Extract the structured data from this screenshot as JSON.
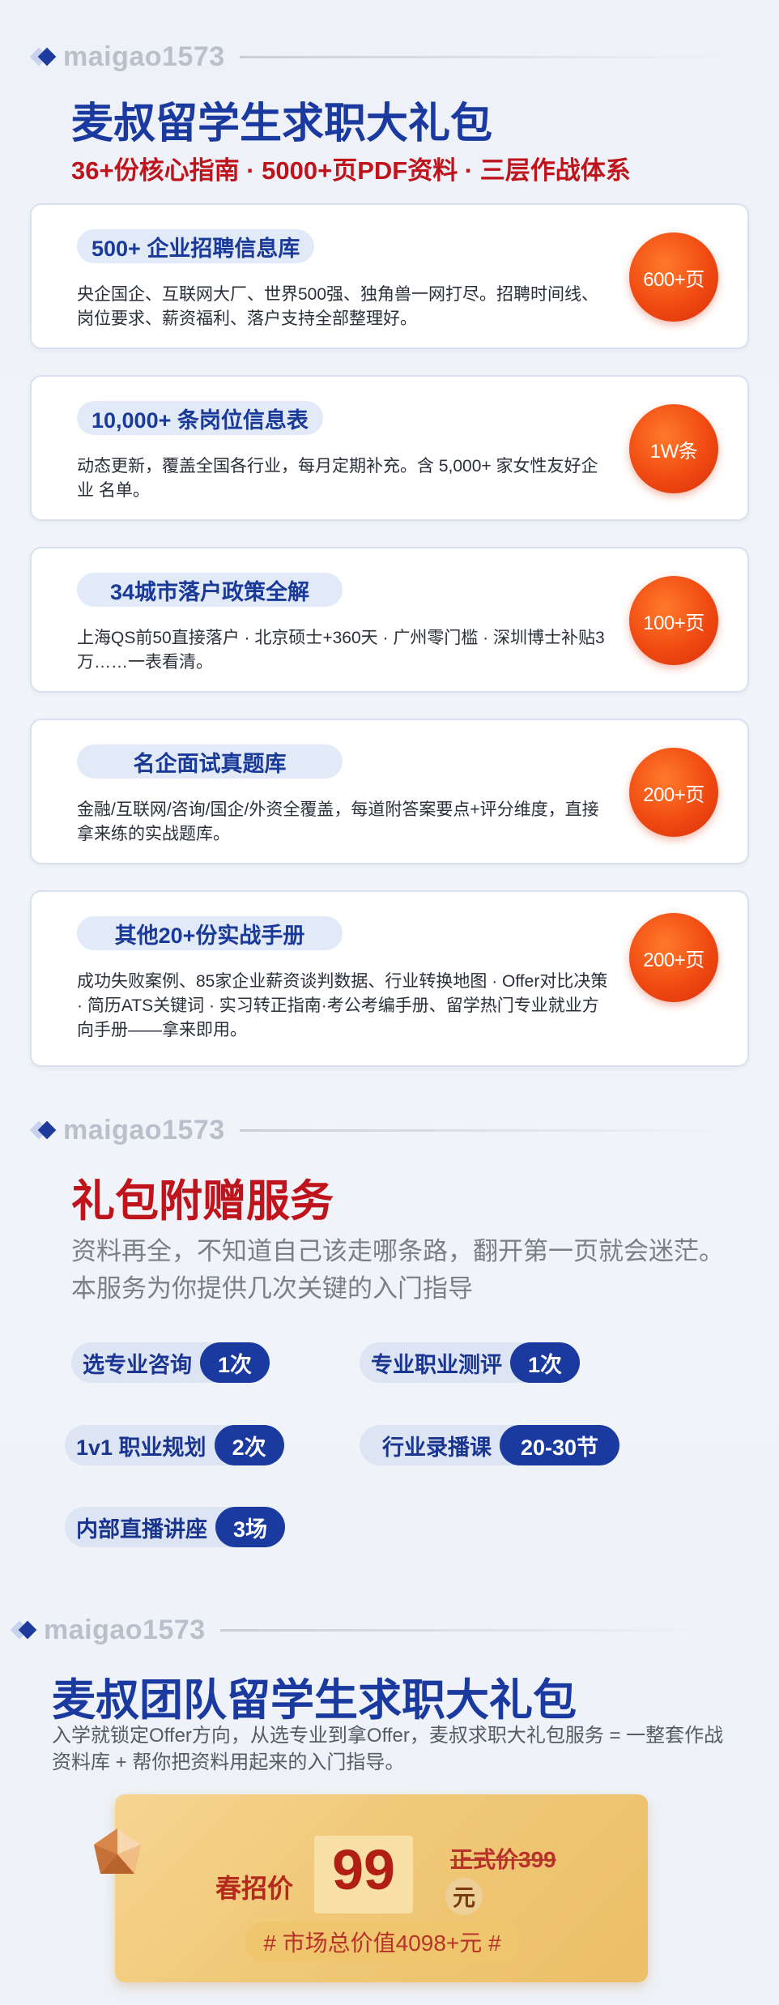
{
  "brand": "maigao1573",
  "section1": {
    "title": "麦叔留学生求职大礼包",
    "subtitle": "36+份核心指南 · 5000+页PDF资料 · 三层作战体系"
  },
  "cards": [
    {
      "pill": "500+ 企业招聘信息库",
      "desc": "央企国企、互联网大厂、世界500强、独角兽一网打尽。招聘时间线、岗位要求、薪资福利、落户支持全部整理好。",
      "badge": "600+页"
    },
    {
      "pill": "10,000+ 条岗位信息表",
      "desc": "动态更新，覆盖全国各行业，每月定期补充。含 5,000+ 家女性友好企业 名单。",
      "badge": "1W条"
    },
    {
      "pill": "34城市落户政策全解",
      "desc": "上海QS前50直接落户 · 北京硕士+360天 · 广州零门槛 · 深圳博士补贴3万……一表看清。",
      "badge": "100+页"
    },
    {
      "pill": "名企面试真题库",
      "desc": "金融/互联网/咨询/国企/外资全覆盖，每道附答案要点+评分维度，直接拿来练的实战题库。",
      "badge": "200+页"
    },
    {
      "pill": "其他20+份实战手册",
      "desc": "成功失败案例、85家企业薪资谈判数据、行业转换地图 · Offer对比决策 · 简历ATS关键词 · 实习转正指南·考公考编手册、留学热门专业就业方向手册——拿来即用。",
      "badge": "200+页"
    }
  ],
  "section2": {
    "title": "礼包附赠服务",
    "desc": "资料再全，不知道自己该走哪条路，翻开第一页就会迷茫。本服务为你提供几次关键的入门指导",
    "services": [
      {
        "name": "选专业咨询",
        "count": "1次"
      },
      {
        "name": "专业职业测评",
        "count": "1次"
      },
      {
        "name": "1v1 职业规划",
        "count": "2次"
      },
      {
        "name": "行业录播课",
        "count": "20-30节"
      },
      {
        "name": "内部直播讲座",
        "count": "3场"
      }
    ]
  },
  "section3": {
    "title": "麦叔团队留学生求职大礼包",
    "desc": "入学就锁定Offer方向，从选专业到拿Offer，麦叔求职大礼包服务 = 一整套作战资料库 + 帮你把资料用起来的入门指导。",
    "price_label": "春招价",
    "price": "99",
    "original_price": "正式价399",
    "currency": "元",
    "market_value": "# 市场总价值4098+元 #"
  },
  "colors": {
    "primary_blue": "#1a3aa0",
    "accent_red": "#c0141c",
    "badge_orange": "#f04a12",
    "gold": "#f0c877"
  }
}
